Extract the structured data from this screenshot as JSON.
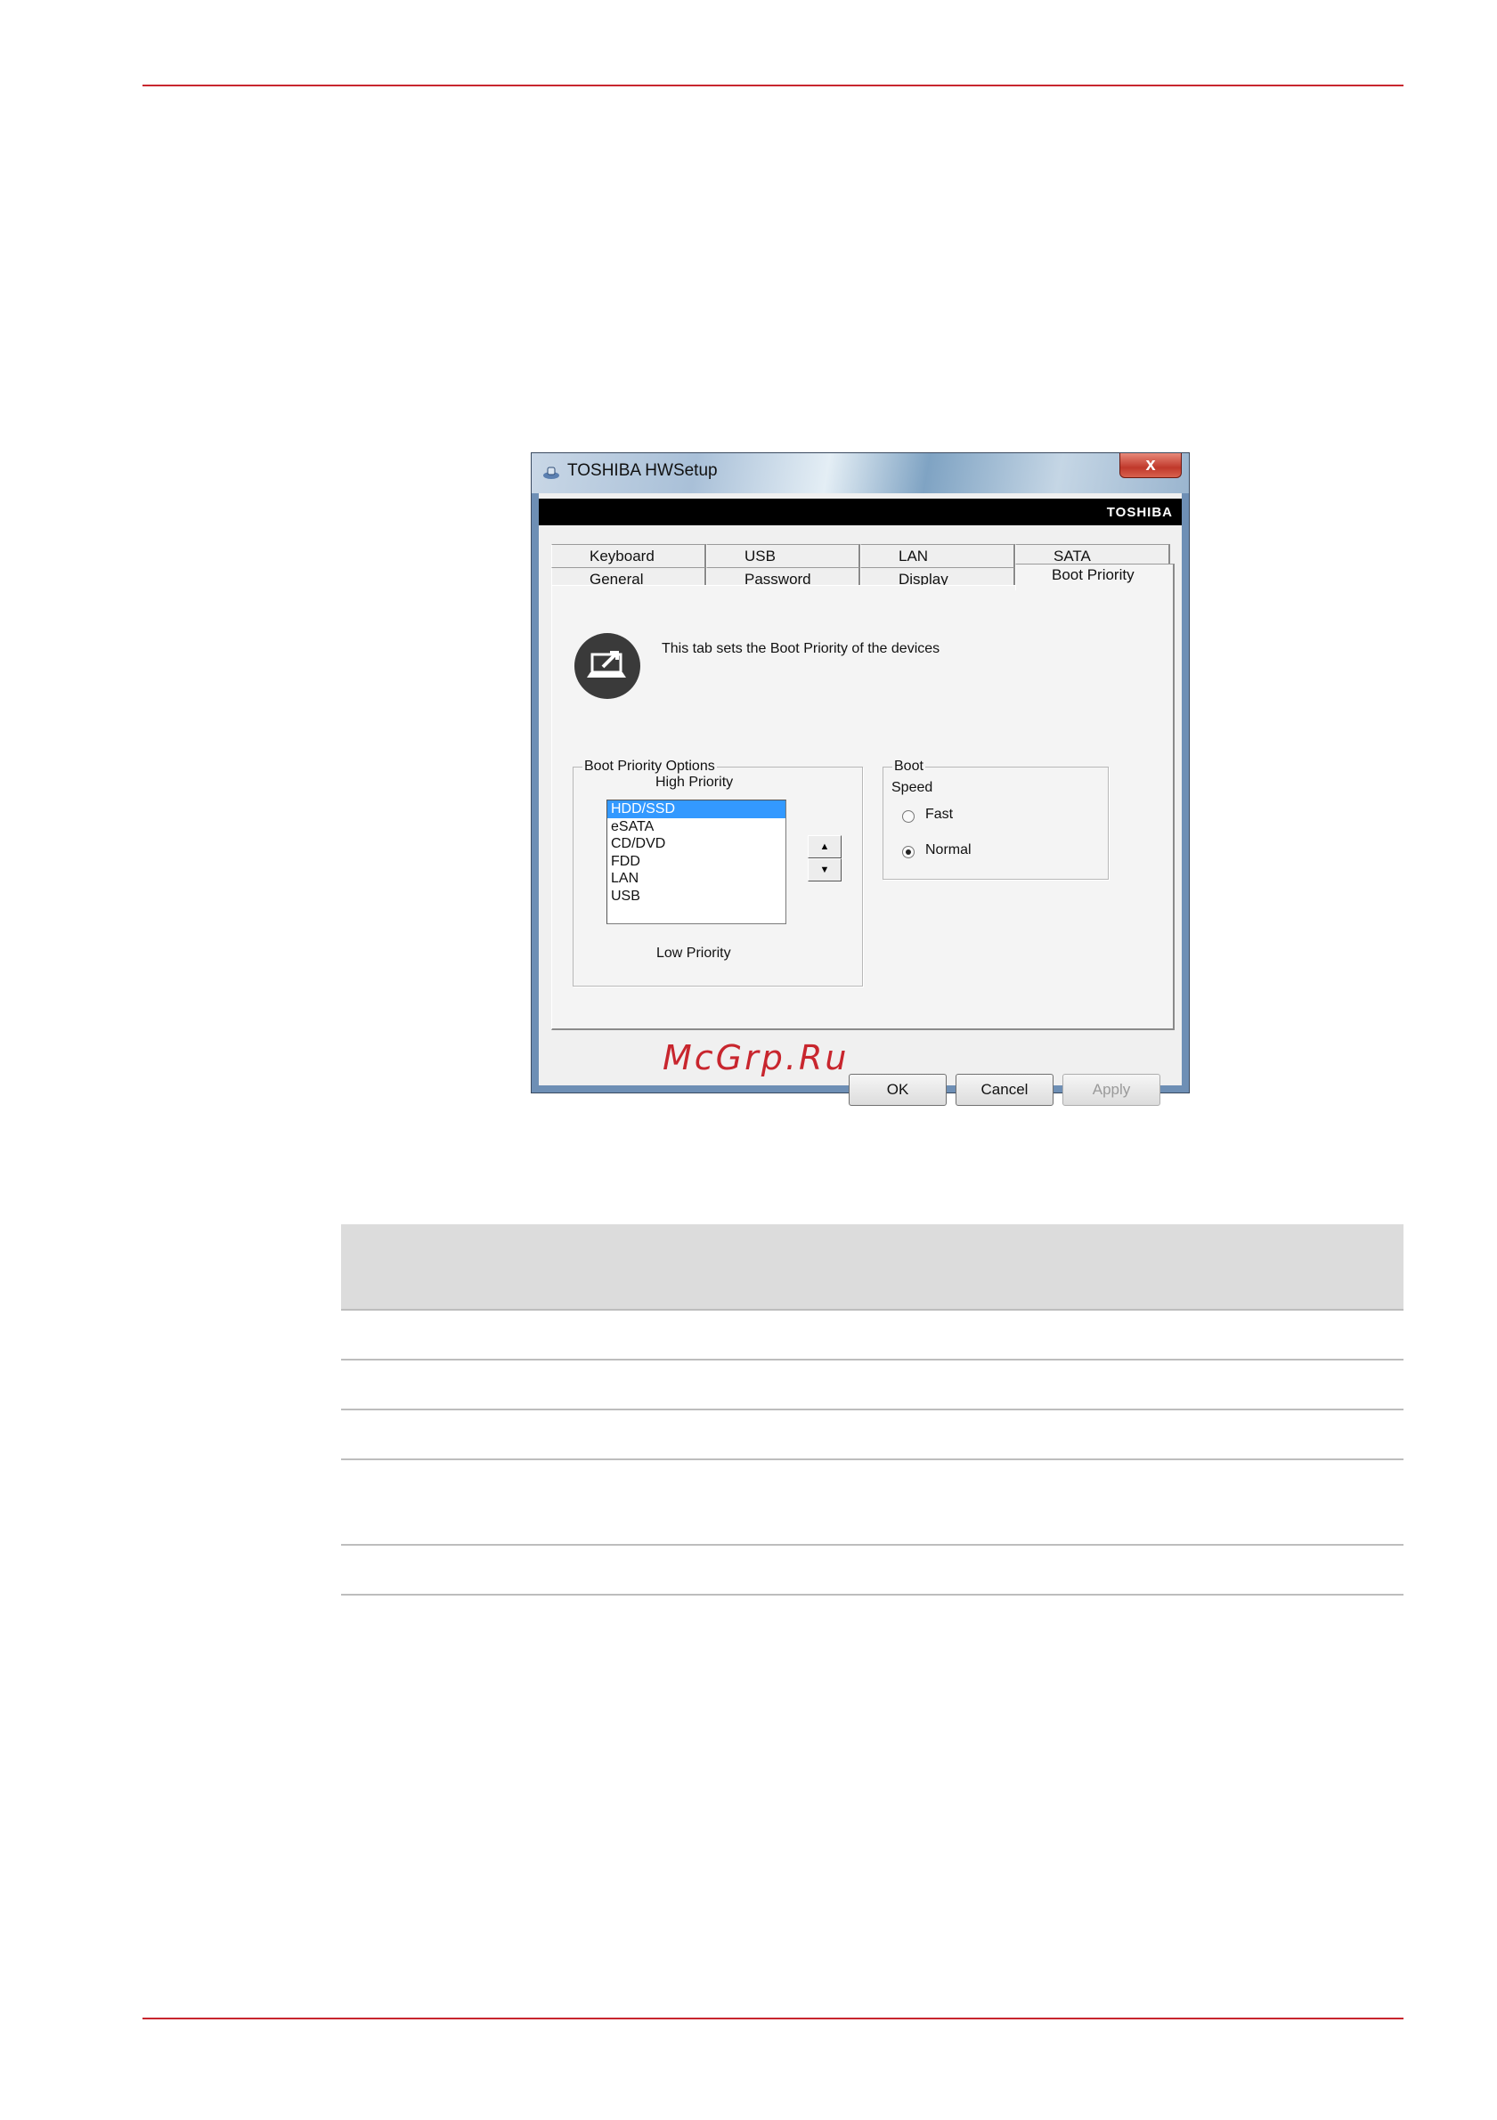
{
  "dialog": {
    "title": "TOSHIBA HWSetup",
    "close_label": "x",
    "brand": "TOSHIBA",
    "tabs_row1": [
      "Keyboard",
      "USB",
      "LAN",
      "SATA"
    ],
    "tabs_row2": [
      "General",
      "Password",
      "Display",
      "Boot Priority"
    ],
    "active_tab": "Boot Priority",
    "info_text": "This tab sets the Boot Priority of the devices",
    "boot_options": {
      "legend": "Boot Priority Options",
      "high_label": "High Priority",
      "low_label": "Low Priority",
      "items": [
        "HDD/SSD",
        "eSATA",
        "CD/DVD",
        "FDD",
        "LAN",
        "USB"
      ],
      "selected": "HDD/SSD"
    },
    "boot_speed": {
      "legend": "Boot",
      "label": "Speed",
      "options": [
        "Fast",
        "Normal"
      ],
      "selected": "Normal"
    },
    "buttons": {
      "ok": "OK",
      "cancel": "Cancel",
      "apply": "Apply"
    }
  },
  "watermark": "McGrp.Ru"
}
